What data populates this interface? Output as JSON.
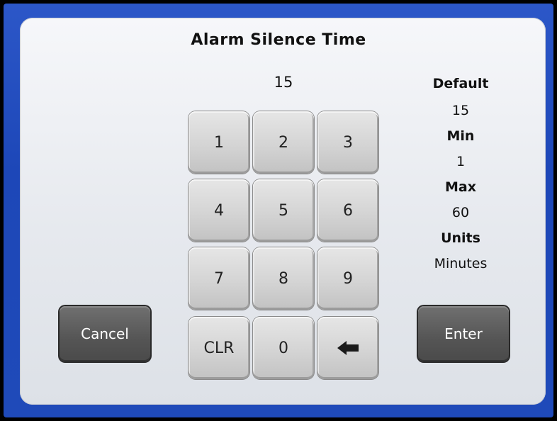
{
  "dialog": {
    "title": "Alarm Silence Time",
    "entry_value": "15"
  },
  "keypad": {
    "keys": [
      "1",
      "2",
      "3",
      "4",
      "5",
      "6",
      "7",
      "8",
      "9",
      "CLR",
      "0"
    ],
    "backspace_icon": "backspace-arrow-icon"
  },
  "info": {
    "default_label": "Default",
    "default_value": "15",
    "min_label": "Min",
    "min_value": "1",
    "max_label": "Max",
    "max_value": "60",
    "units_label": "Units",
    "units_value": "Minutes"
  },
  "buttons": {
    "cancel_label": "Cancel",
    "enter_label": "Enter"
  },
  "colors": {
    "frame_blue": "#1f4ab9",
    "button_dark": "#555555",
    "key_gray": "#d4d4d4"
  }
}
